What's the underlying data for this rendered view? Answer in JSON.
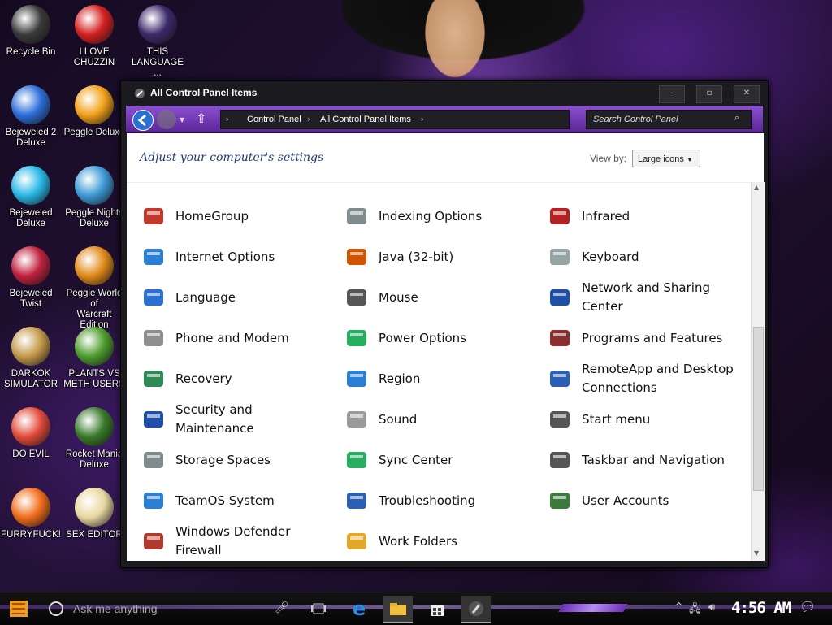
{
  "desktop_icons": [
    {
      "label": "Recycle Bin",
      "label2": "",
      "color": "#3a3a3a"
    },
    {
      "label": "I LOVE",
      "label2": "CHUZZIN",
      "color": "#d42020"
    },
    {
      "label": "THIS",
      "label2": "LANGUAGE ...",
      "color": "#3b2a6a"
    },
    {
      "label": "Bejeweled 2",
      "label2": "Deluxe",
      "color": "#2c6ed8"
    },
    {
      "label": "Peggle Deluxe",
      "label2": "",
      "color": "#f2a11a"
    },
    {
      "label": "Bejeweled",
      "label2": "Deluxe",
      "color": "#29b8e8"
    },
    {
      "label": "Peggle Nights",
      "label2": "Deluxe",
      "color": "#3e9ad6"
    },
    {
      "label": "Bejeweled",
      "label2": "Twist",
      "color": "#c0213e"
    },
    {
      "label": "Peggle World of",
      "label2": "Warcraft Edition",
      "color": "#e08a1a"
    },
    {
      "label": "DARKOK",
      "label2": "SIMULATOR",
      "color": "#c49a4a"
    },
    {
      "label": "PLANTS VS",
      "label2": "METH USERS",
      "color": "#4e9d2d"
    },
    {
      "label": "DO EVIL",
      "label2": "",
      "color": "#e24a3a"
    },
    {
      "label": "Rocket Mania",
      "label2": "Deluxe",
      "color": "#3a7a2a"
    },
    {
      "label": "FURRYFUCK!",
      "label2": "",
      "color": "#f06d1a"
    },
    {
      "label": "SEX EDITOR",
      "label2": "",
      "color": "#e8d8a0"
    }
  ],
  "window": {
    "title": "All Control Panel Items",
    "breadcrumb": [
      "Control Panel",
      "All Control Panel Items"
    ],
    "search_placeholder": "Search Control Panel",
    "heading": "Adjust your computer's settings",
    "view_by_label": "View by:",
    "view_by_value": "Large icons"
  },
  "items": [
    {
      "label": "HomeGroup",
      "icon": "homegroup-icon",
      "color": "#c0392b"
    },
    {
      "label": "Indexing Options",
      "icon": "indexing-icon",
      "color": "#7f8c8d"
    },
    {
      "label": "Infrared",
      "icon": "infrared-icon",
      "color": "#b22222"
    },
    {
      "label": "Internet Options",
      "icon": "internet-options-icon",
      "color": "#2a7fd4"
    },
    {
      "label": "Java (32-bit)",
      "icon": "java-icon",
      "color": "#d35400"
    },
    {
      "label": "Keyboard",
      "icon": "keyboard-icon",
      "color": "#95a5a6"
    },
    {
      "label": "Language",
      "icon": "language-icon",
      "color": "#2a6fd4"
    },
    {
      "label": "Mouse",
      "icon": "mouse-icon",
      "color": "#555555"
    },
    {
      "label": "Network and Sharing Center",
      "icon": "network-icon",
      "color": "#1f4fa8"
    },
    {
      "label": "Phone and Modem",
      "icon": "phone-icon",
      "color": "#8e8e8e"
    },
    {
      "label": "Power Options",
      "icon": "power-icon",
      "color": "#27ae60"
    },
    {
      "label": "Programs and Features",
      "icon": "programs-icon",
      "color": "#8b2e2e"
    },
    {
      "label": "Recovery",
      "icon": "recovery-icon",
      "color": "#2e8b57"
    },
    {
      "label": "Region",
      "icon": "region-icon",
      "color": "#2a7fd4"
    },
    {
      "label": "RemoteApp and Desktop Connections",
      "icon": "remoteapp-icon",
      "color": "#2a5fb4"
    },
    {
      "label": "Security and Maintenance",
      "icon": "security-icon",
      "color": "#1f4fa8"
    },
    {
      "label": "Sound",
      "icon": "sound-icon",
      "color": "#9a9a9a"
    },
    {
      "label": "Start menu",
      "icon": "start-menu-icon",
      "color": "#555555"
    },
    {
      "label": "Storage Spaces",
      "icon": "storage-icon",
      "color": "#7f8c8d"
    },
    {
      "label": "Sync Center",
      "icon": "sync-icon",
      "color": "#27ae60"
    },
    {
      "label": "Taskbar and Navigation",
      "icon": "taskbar-icon",
      "color": "#555555"
    },
    {
      "label": "TeamOS System",
      "icon": "teamos-icon",
      "color": "#2a7fd4"
    },
    {
      "label": "Troubleshooting",
      "icon": "troubleshooting-icon",
      "color": "#2a5fb4"
    },
    {
      "label": "User Accounts",
      "icon": "user-accounts-icon",
      "color": "#3a7a3a"
    },
    {
      "label": "Windows Defender Firewall",
      "icon": "firewall-icon",
      "color": "#b03a2e"
    },
    {
      "label": "Work Folders",
      "icon": "work-folders-icon",
      "color": "#e2a82a"
    }
  ],
  "taskbar": {
    "search_placeholder": "Ask me anything",
    "time": "4:56 AM"
  }
}
